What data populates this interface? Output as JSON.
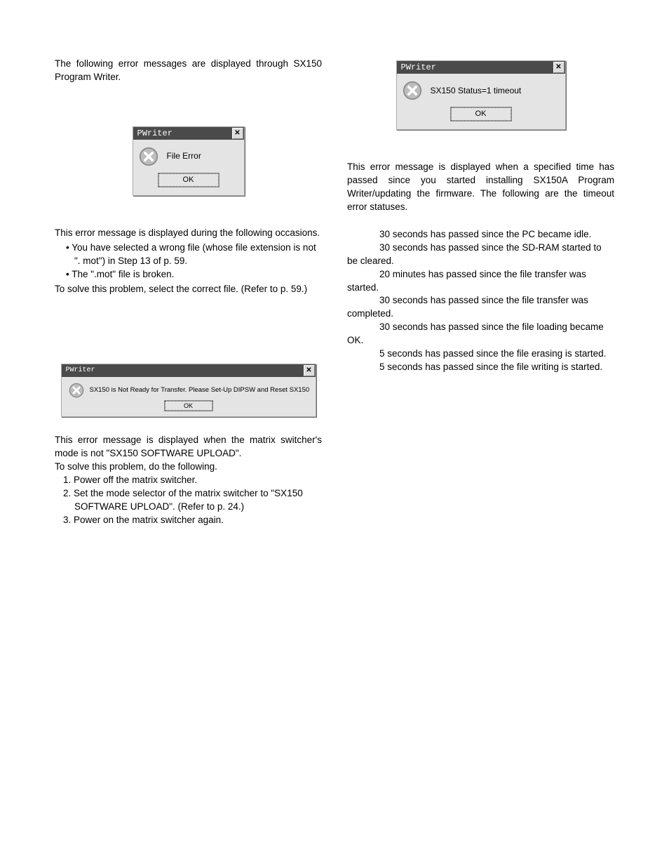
{
  "intro": "The following error messages are displayed through SX150 Program Writer.",
  "dialog1": {
    "title": "PWriter",
    "message": "File Error",
    "ok": "OK"
  },
  "para1a": "This error message is displayed during the following occasions.",
  "bullets1": [
    "You have selected a wrong file (whose file extension is not \". mot\") in Step 13 of p. 59.",
    "The \".mot\" file is broken."
  ],
  "para1b": "To solve this problem, select the correct file. (Refer to p. 59.)",
  "dialog2": {
    "title": "PWriter",
    "message": "SX150 is Not Ready for Transfer. Please Set-Up DIPSW and Reset SX150",
    "ok": "OK"
  },
  "para2a": "This error message is displayed when the matrix switcher's mode is not \"SX150 SOFTWARE UPLOAD\".",
  "para2b": "To solve this problem, do the following.",
  "steps2": [
    "Power off the matrix switcher.",
    "Set the mode selector of the matrix switcher to \"SX150 SOFTWARE UPLOAD\". (Refer to p. 24.)",
    "Power on the matrix switcher again."
  ],
  "dialog3": {
    "title": "PWriter",
    "message": "SX150 Status=1 timeout",
    "ok": "OK"
  },
  "para3a": "This error message is displayed when a specified time has passed since you started installing SX150A Program Writer/updating the firmware. The following are the timeout error statuses.",
  "statuses": [
    "30 seconds has passed since the PC became idle.",
    "30 seconds has passed since the SD-RAM started to be cleared.",
    "20 minutes has passed since the file transfer was started.",
    "30 seconds has passed since the file transfer was completed.",
    "30 seconds has passed since the file loading became OK.",
    "5 seconds has passed since the file erasing is started.",
    "5 seconds has passed since the file writing is started."
  ]
}
